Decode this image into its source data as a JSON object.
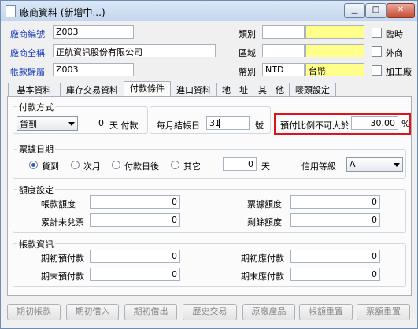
{
  "window": {
    "title": "廠商資料 (新增中...)"
  },
  "header": {
    "vendor_code_label": "廠商編號",
    "vendor_code": "Z003",
    "vendor_name_label": "廠商全稱",
    "vendor_name": "正航資訊股份有限公司",
    "account_label": "帳款歸屬",
    "account": "Z003",
    "category_label": "類別",
    "category": "",
    "category_desc": "",
    "region_label": "區域",
    "region": "",
    "region_desc": "",
    "currency_label": "幣別",
    "currency": "NTD",
    "currency_desc": "台幣",
    "temp_label": "臨時",
    "foreign_label": "外商",
    "processing_label": "加工廠"
  },
  "tabs": [
    "基本資料",
    "庫存交易資料",
    "付款條件",
    "進口資料",
    "地　址",
    "其　他",
    "嘜頭設定"
  ],
  "payment": {
    "method_group": "付款方式",
    "method_value": "貨到",
    "days": "0",
    "days_unit": "天 付款",
    "closing_label": "每月結帳日",
    "closing_value": "31",
    "closing_unit": "號",
    "prepay_label": "預付比例不可大於",
    "prepay_value": "30.00",
    "prepay_unit": "%"
  },
  "bill_date": {
    "group": "票據日期",
    "options": [
      "貨到",
      "次月",
      "付款日後",
      "其它"
    ],
    "selected": "貨到",
    "days": "0",
    "days_unit": "天",
    "credit_label": "信用等級",
    "credit_value": "A"
  },
  "limits": {
    "group": "額度設定",
    "account_limit_label": "帳款額度",
    "account_limit": "0",
    "bill_limit_label": "票據額度",
    "bill_limit": "0",
    "uncashed_label": "累計未兌票",
    "uncashed": "0",
    "remaining_label": "剩餘額度",
    "remaining": "0"
  },
  "account_info": {
    "group": "帳款資訊",
    "opening_prepay_label": "期初預付款",
    "opening_prepay": "0",
    "opening_payable_label": "期初應付款",
    "opening_payable": "0",
    "closing_prepay_label": "期末預付款",
    "closing_prepay": "0",
    "closing_payable_label": "期末應付款",
    "closing_payable": "0"
  },
  "buttons": [
    "期初帳款",
    "期初借入",
    "期初借出",
    "歷史交易",
    "原廠產品",
    "帳額重置",
    "票額重置"
  ]
}
